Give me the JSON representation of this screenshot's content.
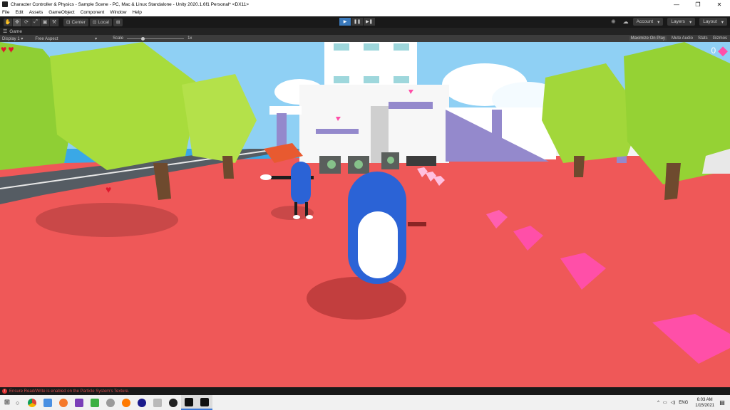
{
  "window": {
    "title": "Character Controller & Physics - Sample Scene - PC, Mac & Linux Standalone - Unity 2020.1.6f1 Personal* <DX11>",
    "minimize": "—",
    "maximize": "❐",
    "close": "✕"
  },
  "menu": [
    "File",
    "Edit",
    "Assets",
    "GameObject",
    "Component",
    "Window",
    "Help"
  ],
  "toolbar": {
    "tools": [
      "✋",
      "✥",
      "⟳",
      "⤢",
      "▣",
      "⚒"
    ],
    "pivot": "Center",
    "space": "Local",
    "grid": "⊞",
    "play": "▶",
    "pause": "❚❚",
    "step": "▶❚",
    "account": "Account",
    "layers": "Layers",
    "layout": "Layout"
  },
  "tab": {
    "label": "Game"
  },
  "game_bar": {
    "display": "Display 1",
    "aspect": "Free Aspect",
    "scale_label": "Scale",
    "scale_value": "1x",
    "maximize": "Maximize On Play",
    "mute": "Mute Audio",
    "stats": "Stats",
    "gizmos": "Gizmos"
  },
  "hud": {
    "hearts": 2,
    "gem_count": "0",
    "gem_color": "#ff4fa8",
    "heart_color": "#e0182e"
  },
  "status": {
    "message": "Ensure Read/Write is enabled on the Particle System's Texture."
  },
  "taskbar": {
    "apps": [
      "chrome",
      "explorer",
      "blender",
      "visual-studio",
      "notepad",
      "disk-utility",
      "audacity",
      "headphones",
      "paint",
      "github",
      "unity-hub",
      "unity-editor"
    ],
    "tray_language": "ENG",
    "time": "6:03 AM",
    "date": "1/15/2021"
  },
  "colors": {
    "ground": "#ef5858",
    "sky": "#8fd0f4",
    "tree": "#9fd63a",
    "player": "#2b63d6",
    "accent": "#3a79bb"
  }
}
